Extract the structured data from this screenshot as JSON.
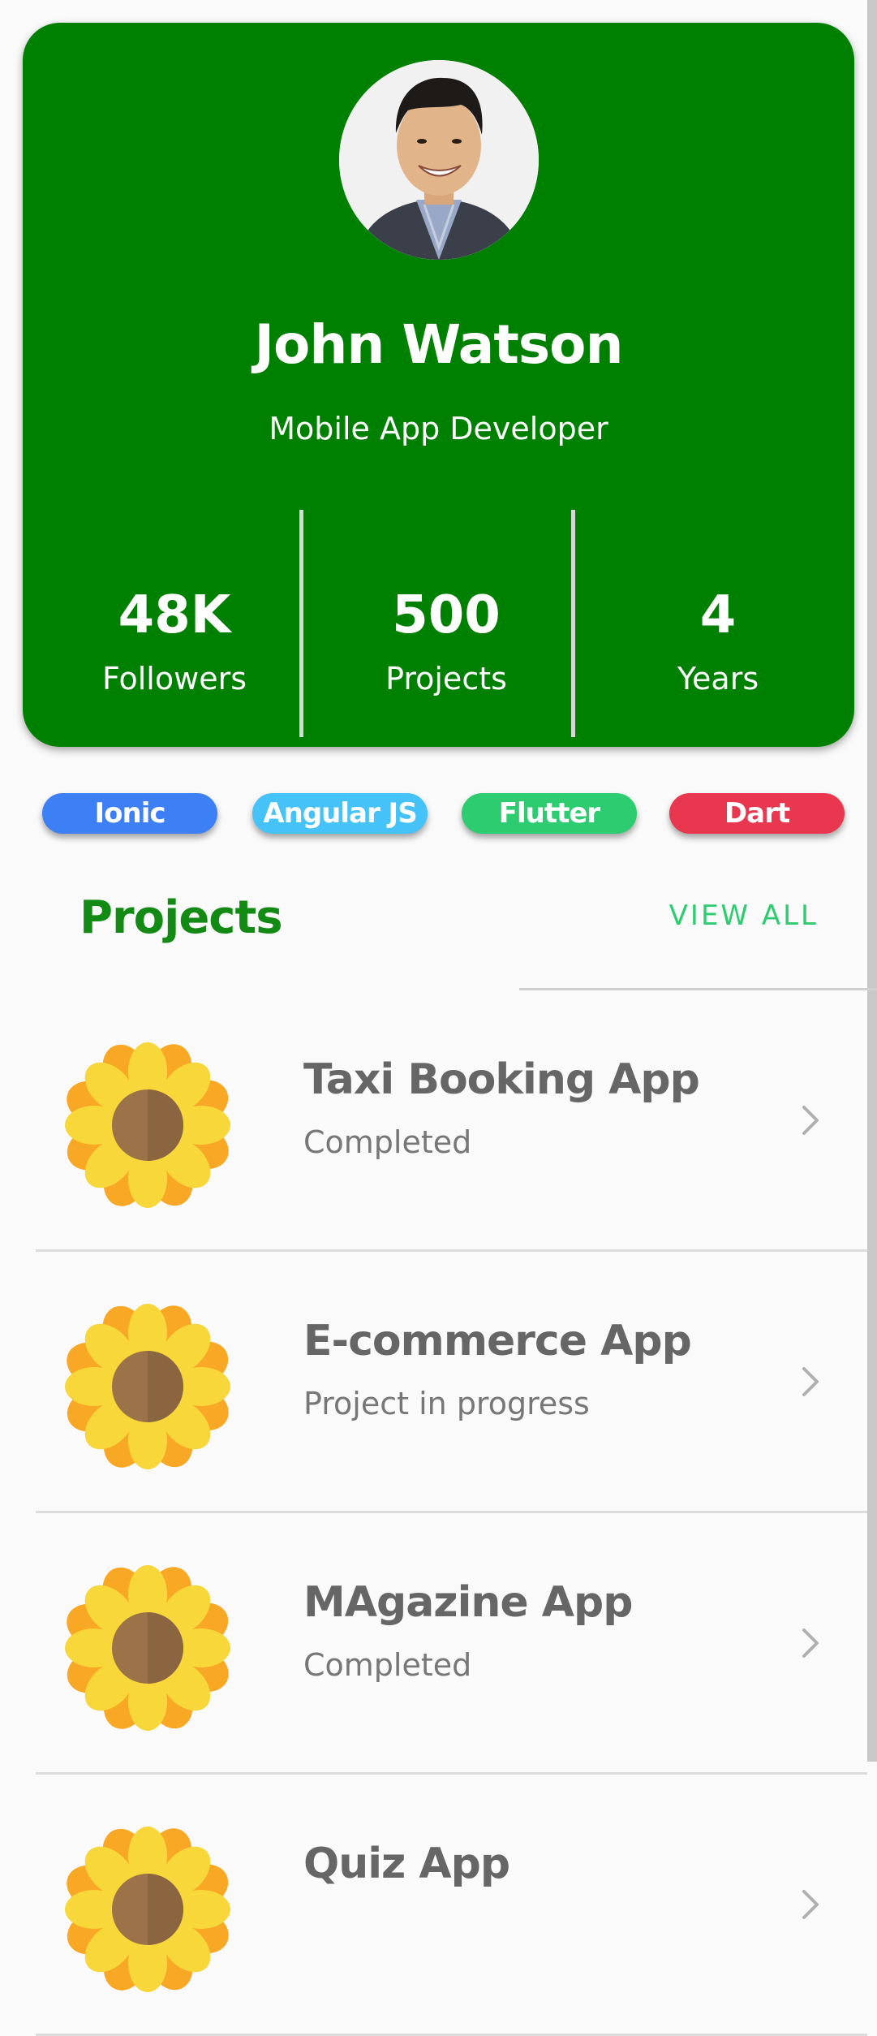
{
  "profile": {
    "name": "John Watson",
    "role": "Mobile App Developer",
    "avatar_icon": "person-avatar-icon",
    "stats": [
      {
        "value": "48K",
        "label": "Followers"
      },
      {
        "value": "500",
        "label": "Projects"
      },
      {
        "value": "4",
        "label": "Years"
      }
    ],
    "card_color": "#008000"
  },
  "skills": [
    {
      "label": "Ionic",
      "color": "#3d7ff5"
    },
    {
      "label": "Angular JS",
      "color": "#45c2f7"
    },
    {
      "label": "Flutter",
      "color": "#2ecc71"
    },
    {
      "label": "Dart",
      "color": "#e8374f"
    }
  ],
  "projects_section": {
    "title": "Projects",
    "view_all_label": "VIEW ALL",
    "items": [
      {
        "title": "Taxi Booking App",
        "status": "Completed",
        "icon": "sunflower-icon"
      },
      {
        "title": "E-commerce App",
        "status": "Project in progress",
        "icon": "sunflower-icon"
      },
      {
        "title": "MAgazine App",
        "status": "Completed",
        "icon": "sunflower-icon"
      },
      {
        "title": "Quiz App",
        "status": "",
        "icon": "sunflower-icon"
      }
    ]
  }
}
